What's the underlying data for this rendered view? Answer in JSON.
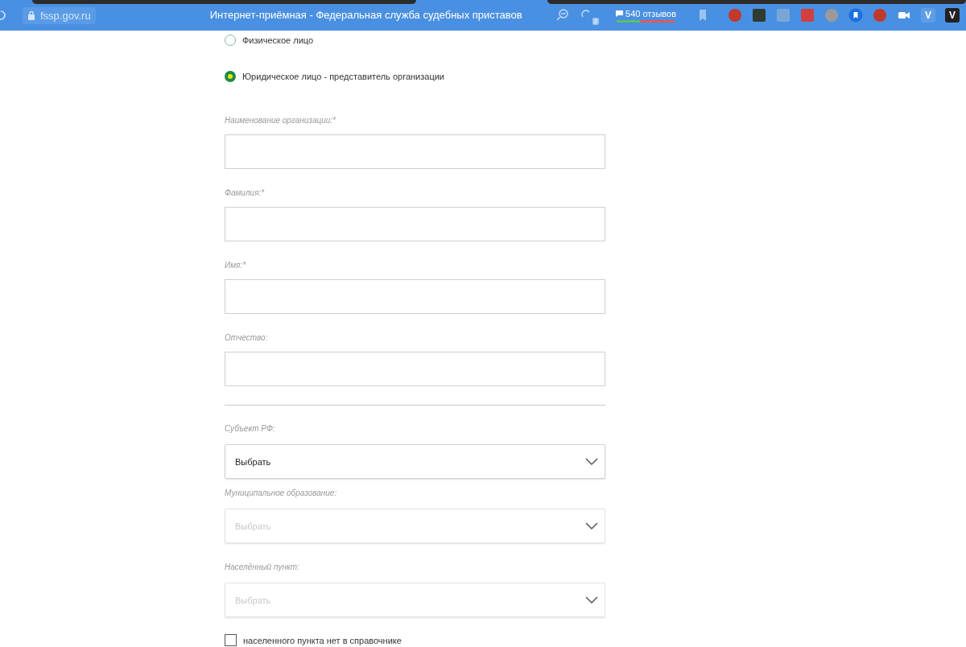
{
  "browser": {
    "address": "fssp.gov.ru",
    "title": "Интернет-приёмная - Федеральная служба судебных приставов",
    "tab_badge": "2",
    "reviews": "540 отзывов",
    "extension_letters": [
      "V",
      "V"
    ]
  },
  "person_type": [
    {
      "label": "Физическое лицо",
      "selected": false
    },
    {
      "label": "Юридическое лицо - представитель организации",
      "selected": true
    }
  ],
  "fields": [
    {
      "label": "Наименование организации:*"
    },
    {
      "label": "Фамилия:*"
    },
    {
      "label": "Имя:*"
    },
    {
      "label": "Отчество:"
    }
  ],
  "selects": [
    {
      "label": "Субъект РФ:",
      "value": "Выбрать",
      "disabled": false
    },
    {
      "label": "Муниципальное образование:",
      "value": "Выбрать",
      "disabled": true
    },
    {
      "label": "Населённый пункт:",
      "value": "Выбрать",
      "disabled": true
    }
  ],
  "no_locality": {
    "label": "населенного пункта нет в справочнике",
    "checked": false
  }
}
